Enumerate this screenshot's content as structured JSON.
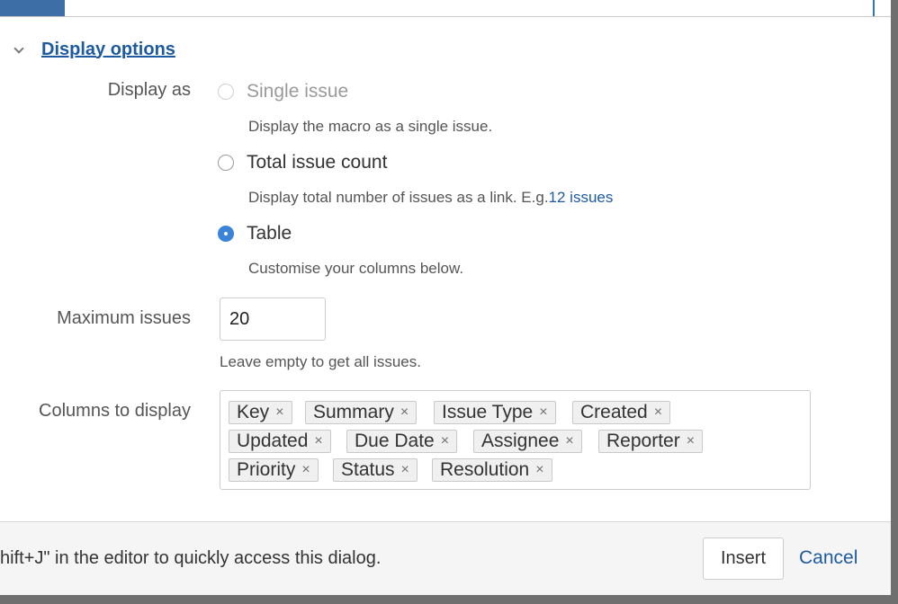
{
  "section": {
    "toggle_label": "Display options",
    "expanded": true
  },
  "display_as": {
    "label": "Display as",
    "options": [
      {
        "label": "Single issue",
        "description": "Display the macro as a single issue.",
        "state": "disabled"
      },
      {
        "label": "Total issue count",
        "description": "Display total number of issues as a link. E.g.",
        "link": "12 issues",
        "state": "unchecked"
      },
      {
        "label": "Table",
        "description": "Customise your columns below.",
        "state": "checked"
      }
    ]
  },
  "max_issues": {
    "label": "Maximum issues",
    "value": "20",
    "hint": "Leave empty to get all issues."
  },
  "columns": {
    "label": "Columns to display",
    "tags": [
      "Key",
      "Summary",
      "Issue Type",
      "Created",
      "Updated",
      "Due Date",
      "Assignee",
      "Reporter",
      "Priority",
      "Status",
      "Resolution"
    ],
    "remove_glyph": "×"
  },
  "footer": {
    "tip": "hift+J\" in the editor to quickly access this dialog.",
    "insert_label": "Insert",
    "cancel_label": "Cancel"
  },
  "colors": {
    "link": "#1e5aa0",
    "radio_checked": "#3b84d9",
    "header_accent": "#3e6ea6"
  }
}
